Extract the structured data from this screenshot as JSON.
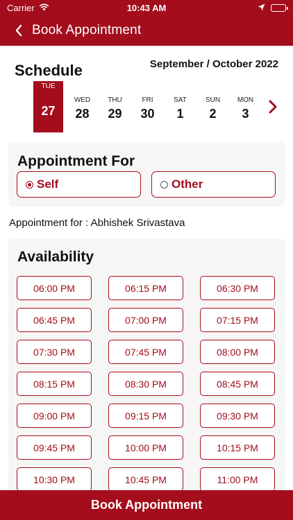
{
  "status_bar": {
    "carrier": "Carrier",
    "time": "10:43 AM"
  },
  "header": {
    "title": "Book Appointment"
  },
  "schedule": {
    "title": "Schedule",
    "month": "September / October 2022",
    "days": [
      {
        "dow": "TUE",
        "num": "27",
        "selected": true
      },
      {
        "dow": "WED",
        "num": "28"
      },
      {
        "dow": "THU",
        "num": "29"
      },
      {
        "dow": "FRI",
        "num": "30"
      },
      {
        "dow": "SAT",
        "num": "1"
      },
      {
        "dow": "SUN",
        "num": "2"
      },
      {
        "dow": "MON",
        "num": "3"
      }
    ]
  },
  "appointment_for": {
    "title": "Appointment For",
    "options": [
      {
        "label": "Self",
        "selected": true
      },
      {
        "label": "Other",
        "selected": false
      }
    ],
    "summary": "Appointment for : Abhishek Srivastava"
  },
  "availability": {
    "title": "Availability",
    "slots": [
      "06:00 PM",
      "06:15 PM",
      "06:30 PM",
      "06:45 PM",
      "07:00 PM",
      "07:15 PM",
      "07:30 PM",
      "07:45 PM",
      "08:00 PM",
      "08:15 PM",
      "08:30 PM",
      "08:45 PM",
      "09:00 PM",
      "09:15 PM",
      "09:30 PM",
      "09:45 PM",
      "10:00 PM",
      "10:15 PM",
      "10:30 PM",
      "10:45 PM",
      "11:00 PM"
    ]
  },
  "footer": {
    "book_label": "Book Appointment"
  },
  "colors": {
    "accent": "#a30d1c",
    "card_bg": "#f6f6f6"
  }
}
